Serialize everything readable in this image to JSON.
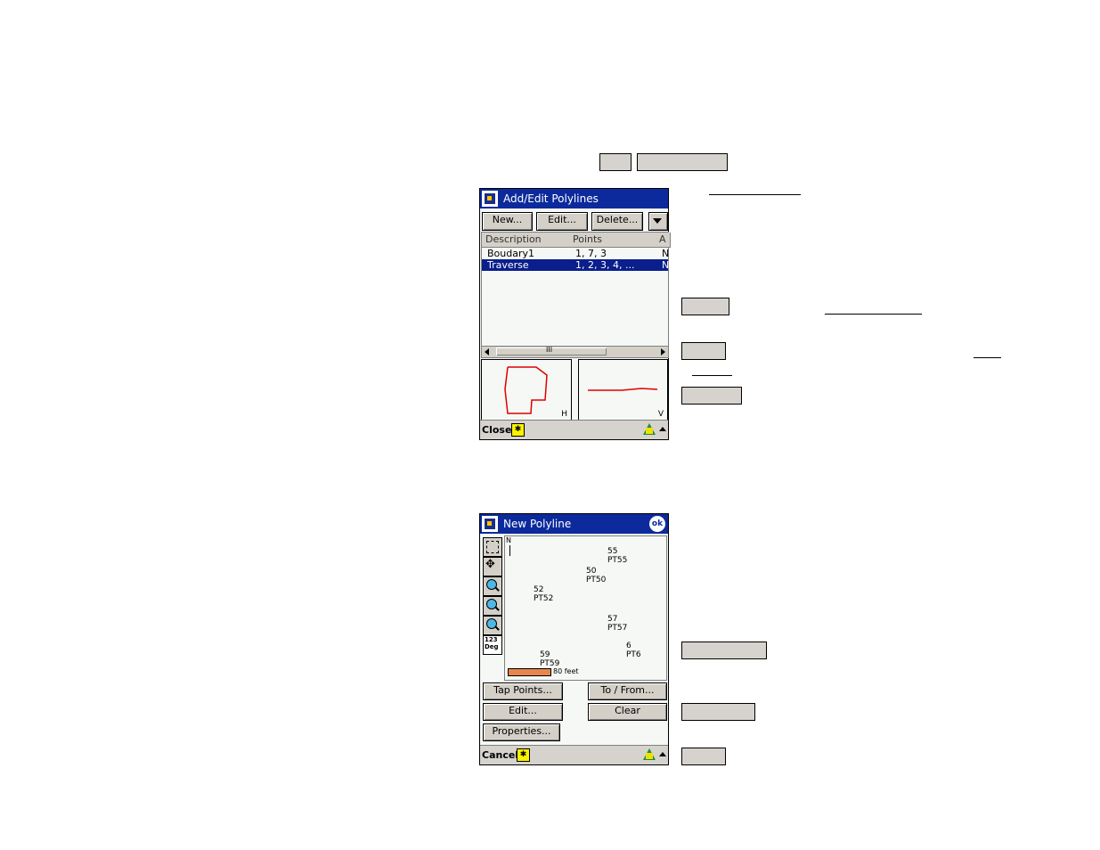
{
  "screen1": {
    "title": "Add/Edit Polylines",
    "buttons": {
      "new": "New...",
      "edit": "Edit...",
      "delete": "Delete..."
    },
    "columns": [
      "Description",
      "Points",
      "A"
    ],
    "rows": [
      {
        "description": "Boudary1",
        "points": "1, 7, 3",
        "a": "N"
      },
      {
        "description": "Traverse",
        "points": "1, 2, 3, 4, ...",
        "a": "N"
      }
    ],
    "scroll_grip": "III",
    "preview_h": "H",
    "preview_v": "V",
    "bottom_label": "Close"
  },
  "screen2": {
    "title": "New Polyline",
    "ok": "ok",
    "north": "N",
    "points": [
      {
        "num": "55",
        "label": "PT55"
      },
      {
        "num": "50",
        "label": "PT50"
      },
      {
        "num": "52",
        "label": "PT52"
      },
      {
        "num": "57",
        "label": "PT57"
      },
      {
        "num": "6",
        "label": "PT6"
      },
      {
        "num": "59",
        "label": "PT59"
      }
    ],
    "scale_text": "80 feet",
    "numeric_tool": "123\nDeg",
    "buttons": {
      "tap_points": "Tap Points...",
      "to_from": "To / From...",
      "edit": "Edit...",
      "clear": "Clear",
      "properties": "Properties..."
    },
    "bottom_label": "Cancel"
  },
  "colors": {
    "titlebar": "#0c2a9c",
    "selection": "#0a1e8c",
    "polyline": "#e00000",
    "scalebar": "#e8864e"
  }
}
